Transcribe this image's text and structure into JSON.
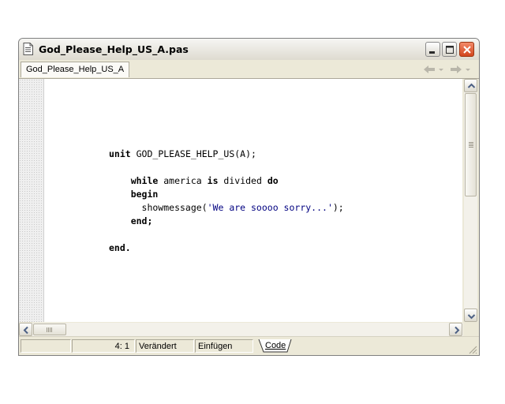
{
  "window": {
    "title": "God_Please_Help_US_A.pas",
    "tab_label": "God_Please_Help_US_A"
  },
  "editor": {
    "lines": [
      [
        {
          "t": "unit",
          "k": "kw"
        },
        {
          "t": " GOD_PLEASE_HELP_US(A);",
          "k": ""
        }
      ],
      [],
      [
        {
          "t": "    ",
          "k": ""
        },
        {
          "t": "while",
          "k": "kw"
        },
        {
          "t": " america ",
          "k": ""
        },
        {
          "t": "is",
          "k": "kw"
        },
        {
          "t": " divided ",
          "k": ""
        },
        {
          "t": "do",
          "k": "kw"
        }
      ],
      [
        {
          "t": "    ",
          "k": ""
        },
        {
          "t": "begin",
          "k": "kw"
        }
      ],
      [
        {
          "t": "      showmessage(",
          "k": ""
        },
        {
          "t": "'We are soooo sorry...'",
          "k": "str"
        },
        {
          "t": ");",
          "k": ""
        }
      ],
      [
        {
          "t": "    ",
          "k": ""
        },
        {
          "t": "end;",
          "k": "kw"
        }
      ],
      [],
      [
        {
          "t": "end.",
          "k": "kw"
        }
      ]
    ]
  },
  "statusbar": {
    "position": "4:  1",
    "modified": "Verändert",
    "mode": "Einfügen",
    "code_tab": "Code"
  },
  "colors": {
    "keyword": "#000000",
    "string": "#000080",
    "gutter": "#efefef",
    "close_button": "#d2451e"
  },
  "icons": {
    "title": "document-icon",
    "back": "back-arrow-icon",
    "forward": "forward-arrow-icon"
  }
}
